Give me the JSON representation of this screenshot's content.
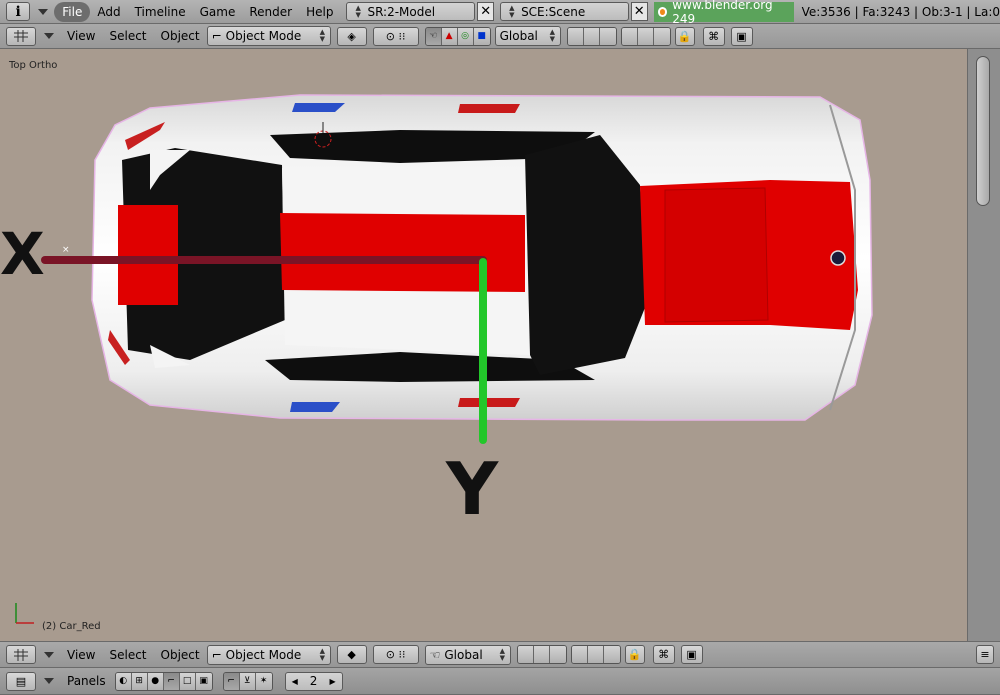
{
  "top_menu": {
    "info_icon": "i",
    "menus": [
      "File",
      "Add",
      "Timeline",
      "Game",
      "Render",
      "Help"
    ],
    "active_menu": "File",
    "screen_name": "SR:2-Model",
    "scene_name": "SCE:Scene",
    "url": "www.blender.org 249",
    "stats": "Ve:3536 | Fa:3243 | Ob:3-1 | La:0"
  },
  "view3d_header": {
    "menus": [
      "View",
      "Select",
      "Object"
    ],
    "mode": "Object Mode",
    "orientation": "Global"
  },
  "viewport": {
    "view_label": "Top Ortho",
    "object_label": "(2) Car_Red",
    "axis_x_label": "X",
    "axis_y_label": "Y",
    "background_color": "#a89b8f"
  },
  "bottom_header": {
    "menus": [
      "View",
      "Select",
      "Object"
    ],
    "mode": "Object Mode",
    "orientation": "Global"
  },
  "panels_bar": {
    "label": "Panels",
    "page_number": "2"
  },
  "colors": {
    "x_axis": "#7a1426",
    "y_axis": "#22c72a",
    "car_stripe": "#e00000",
    "url_bg": "#5ba35b"
  }
}
